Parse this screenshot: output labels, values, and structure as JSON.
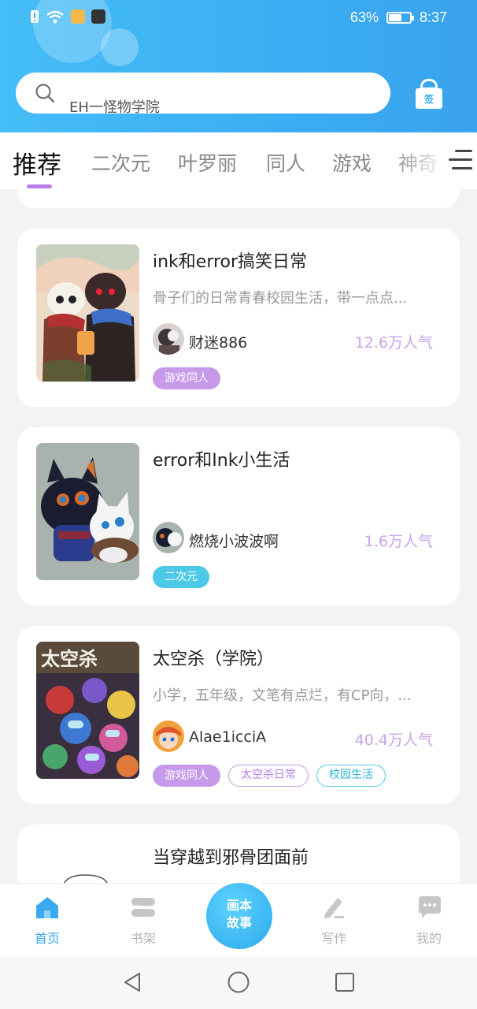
{
  "status": {
    "battery": "63%",
    "time": "8:37",
    "battery_level": 0.63
  },
  "search": {
    "placeholder": "EH一怪物学院"
  },
  "checkin": {
    "label": "签"
  },
  "tabs": [
    {
      "label": "推荐",
      "active": true
    },
    {
      "label": "二次元"
    },
    {
      "label": "叶罗丽"
    },
    {
      "label": "同人"
    },
    {
      "label": "游戏"
    },
    {
      "label": "神奇"
    }
  ],
  "cards": [
    {
      "title": "ink和error搞笑日常",
      "desc": "骨子们的日常青春校园生活，带一点点...",
      "author": "财迷886",
      "popularity": "12.6万人气",
      "tags": [
        "游戏同人"
      ]
    },
    {
      "title": "error和Ink小生活",
      "desc": "",
      "author": "燃烧小波波啊",
      "popularity": "1.6万人气",
      "tags": [
        "二次元"
      ]
    },
    {
      "title": "太空杀（学院）",
      "desc": "小学，五年级，文笔有点烂，有CP向，...",
      "author": "Alae1icciA",
      "popularity": "40.4万人气",
      "tags": [
        "游戏同人",
        "太空杀日常",
        "校园生活"
      ]
    },
    {
      "title": "当穿越到邪骨团面前"
    }
  ],
  "bottom_nav": [
    {
      "label": "首页",
      "icon": "home-icon",
      "active": true
    },
    {
      "label": "书架",
      "icon": "bookshelf-icon"
    },
    {
      "label": "画本故事",
      "line1": "画本",
      "line2": "故事",
      "icon": "create-story-button"
    },
    {
      "label": "写作",
      "icon": "pen-icon"
    },
    {
      "label": "我的",
      "icon": "chat-bubble-icon"
    }
  ],
  "colors": {
    "header": "#3aaef2",
    "accent_purple": "#b77ee9",
    "accent_cyan": "#4cc9e6",
    "popularity": "#c9a3ec"
  }
}
